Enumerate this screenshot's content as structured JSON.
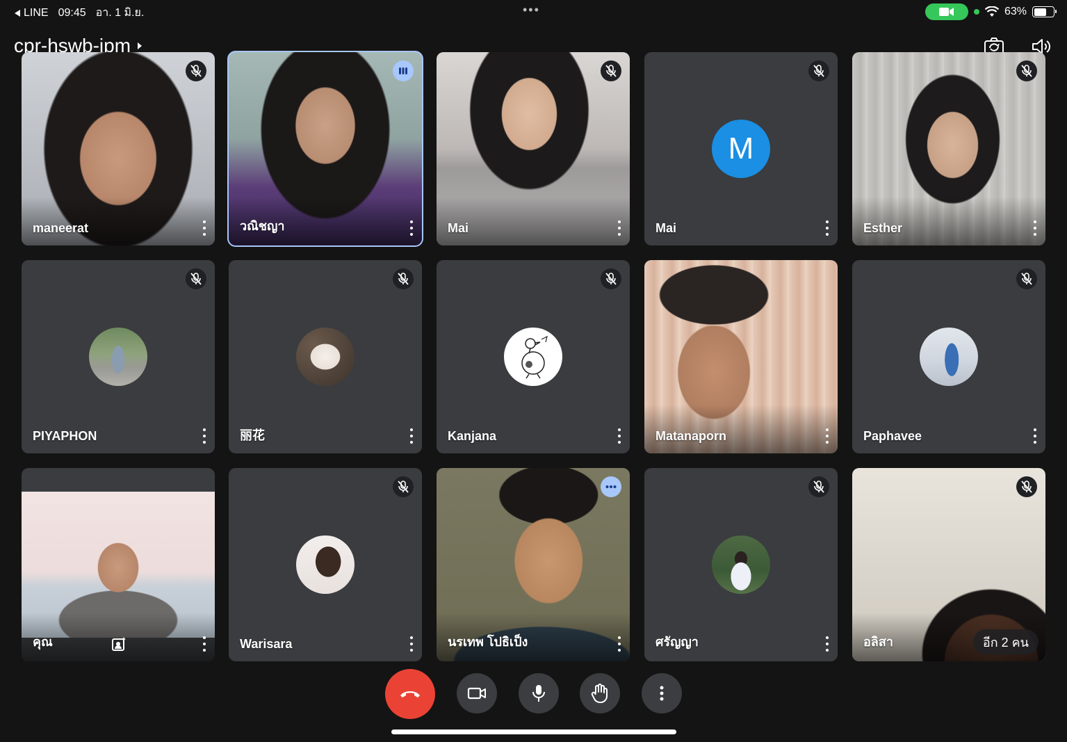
{
  "status_bar": {
    "back_app": "LINE",
    "time": "09:45",
    "date": "อา. 1 มิ.ย.",
    "multitask_dots": "•••",
    "battery_percent": "63%",
    "battery_level": 0.63
  },
  "meeting": {
    "code": "cpr-hswb-ipm"
  },
  "participants": [
    {
      "name": "maneerat",
      "muted": true
    },
    {
      "name": "วณิชญา",
      "speaking": true
    },
    {
      "name": "Mai",
      "muted": true
    },
    {
      "name": "Mai",
      "muted": true,
      "avatar_letter": "M"
    },
    {
      "name": "Esther",
      "muted": true
    },
    {
      "name": "PIYAPHON",
      "muted": true
    },
    {
      "name": "丽花",
      "muted": true
    },
    {
      "name": "Kanjana",
      "muted": true
    },
    {
      "name": "Matanaporn",
      "muted": false
    },
    {
      "name": "Paphavee",
      "muted": true
    },
    {
      "name": "คุณ",
      "self": true
    },
    {
      "name": "Warisara",
      "muted": true
    },
    {
      "name": "นรเทพ โปธิเป็ง",
      "more_badge": true
    },
    {
      "name": "ศรัญญา",
      "muted": true
    },
    {
      "name": "อลิสา",
      "muted": true,
      "overflow_label": "อีก 2 คน"
    }
  ],
  "colors": {
    "background": "#141414",
    "tile": "#3a3c3f",
    "end_call": "#ea4335",
    "active_outline": "#a8c7fa",
    "avatar_blue": "#1a8fe3",
    "camera_pill": "#35c759"
  },
  "controls": [
    {
      "icon": "end-call-icon"
    },
    {
      "icon": "camera-icon"
    },
    {
      "icon": "microphone-icon"
    },
    {
      "icon": "raise-hand-icon"
    },
    {
      "icon": "more-options-icon"
    }
  ]
}
